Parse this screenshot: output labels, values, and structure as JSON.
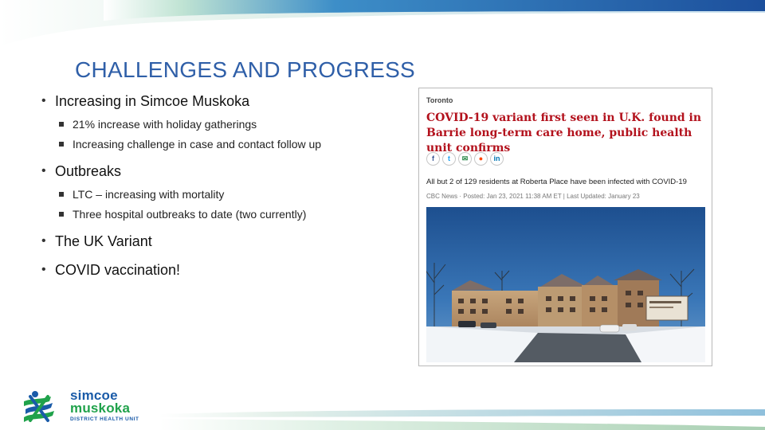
{
  "slide": {
    "title": "CHALLENGES AND PROGRESS",
    "bullets": [
      {
        "text": "Increasing in Simcoe Muskoka",
        "sub": [
          "21% increase with holiday gatherings",
          "Increasing challenge in case and contact follow up"
        ]
      },
      {
        "text": "Outbreaks",
        "sub": [
          "LTC – increasing with mortality",
          "Three hospital outbreaks to date (two currently)"
        ]
      },
      {
        "text": "The UK Variant",
        "sub": []
      },
      {
        "text": "COVID vaccination!",
        "sub": []
      }
    ]
  },
  "article": {
    "section": "Toronto",
    "headline": "COVID-19 variant first seen in U.K. found in Barrie long-term care home, public health unit confirms",
    "social_icons": [
      "facebook-icon",
      "twitter-icon",
      "email-icon",
      "reddit-icon",
      "linkedin-icon"
    ],
    "summary": "All but 2 of 129 residents at Roberta Place have been infected with COVID-19",
    "byline": "CBC News · Posted: Jan 23, 2021 11:38 AM ET | Last Updated: January 23"
  },
  "logo": {
    "line1": "simcoe",
    "line2": "muskoka",
    "line3": "DISTRICT HEALTH UNIT"
  },
  "colors": {
    "title": "#2f5fa8",
    "headline": "#b3121d",
    "brand_blue": "#1a5ba8",
    "brand_green": "#20a24b"
  }
}
